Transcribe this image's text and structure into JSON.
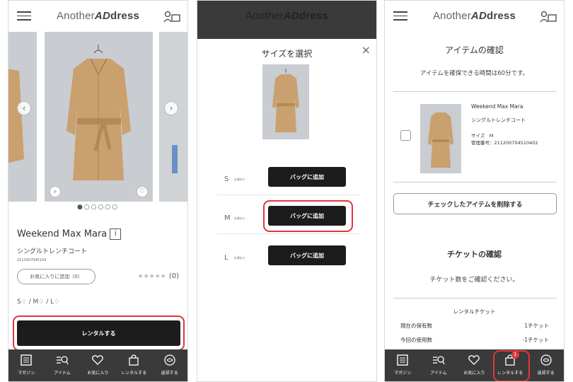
{
  "brand": {
    "part1": "Another",
    "part2": "AD",
    "part3": "dress"
  },
  "tabs": [
    {
      "label": "マガジン",
      "icon": "magazine-icon"
    },
    {
      "label": "アイテム",
      "icon": "item-search-icon"
    },
    {
      "label": "お気に入り",
      "icon": "heart-icon"
    },
    {
      "label": "レンタルする",
      "icon": "bag-icon"
    },
    {
      "label": "返却する",
      "icon": "return-icon"
    }
  ],
  "product": {
    "brand_name": "Weekend Max Mara",
    "info_icon": "i",
    "name": "シングルトレンチコート",
    "item_number": "2112007045104",
    "favorite_button": "お気に入りに追加（0）",
    "stars": "★★★★★",
    "review_count": "(0)",
    "sizes": "S♢ / M♢ / L♢",
    "rent_button": "レンタルする",
    "dots": "●○○○○○",
    "prev_arrow": "‹",
    "next_arrow": "›"
  },
  "size_modal": {
    "title": "サイズを選択",
    "close": "×",
    "rows": [
      {
        "size": "S",
        "stock": "在庫あり",
        "button": "バッグに追加"
      },
      {
        "size": "M",
        "stock": "在庫あり",
        "button": "バッグに追加"
      },
      {
        "size": "L",
        "stock": "在庫あり",
        "button": "バッグに追加"
      }
    ]
  },
  "confirm": {
    "title": "アイテムの確認",
    "hold_note": "アイテムを確保できる時間は60分です。",
    "item_brand": "Weekend Max Mara",
    "item_name": "シングルトレンチコート",
    "item_size": "サイズ　M",
    "item_mgmt": "管理番号：211200704510402",
    "delete_button": "チェックしたアイテムを削除する",
    "ticket_title": "チケットの確認",
    "ticket_note": "チケット数をご確認ください。",
    "rental_ticket_label": "レンタルチケット",
    "owned_label": "現在の保有数",
    "owned_value": "1チケット",
    "used_label": "今回の使用数",
    "used_value": "-1チケット",
    "cart_badge": "1"
  },
  "colors": {
    "accent": "#e0383a",
    "dark": "#1c1c1c",
    "tabbar": "#3a3a3a",
    "coat": "#c9a06e"
  }
}
